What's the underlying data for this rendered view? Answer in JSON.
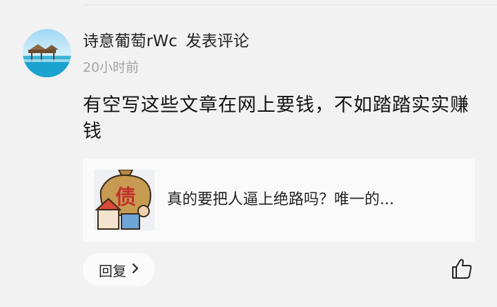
{
  "comment": {
    "author": "诗意葡萄rWc",
    "action": "发表评论",
    "time": "20小时前",
    "text": "有空写这些文章在网上要钱，不如踏踏实实赚钱"
  },
  "article": {
    "title": "真的要把人逼上绝路吗？唯一的...",
    "thumbnail_glyph": "债"
  },
  "actions": {
    "reply_label": "回复"
  },
  "icons": {
    "avatar": "beach-pier-avatar",
    "reply": "chevron-right-icon",
    "like": "thumbs-up-icon"
  }
}
